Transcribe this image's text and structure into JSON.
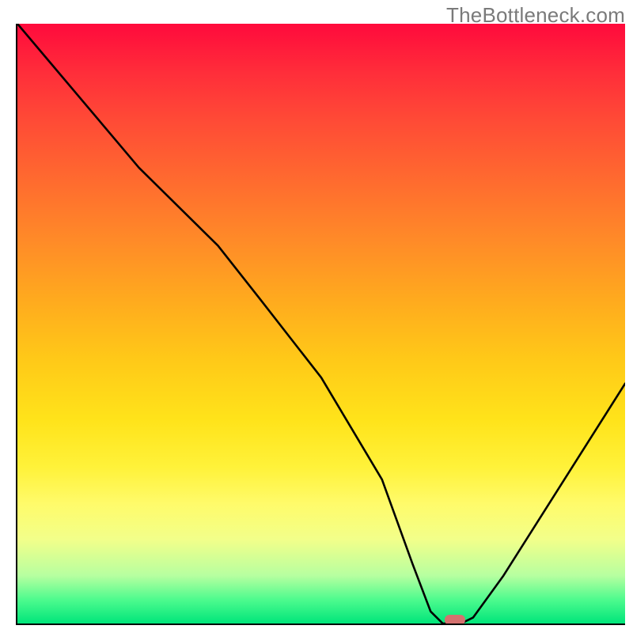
{
  "watermark": "TheBottleneck.com",
  "chart_data": {
    "type": "line",
    "title": "",
    "xlabel": "",
    "ylabel": "",
    "x": [
      0,
      5,
      10,
      15,
      20,
      25,
      30,
      33,
      40,
      50,
      60,
      65,
      68,
      70,
      73,
      75,
      80,
      85,
      90,
      95,
      100
    ],
    "values": [
      100,
      94,
      88,
      82,
      76,
      71,
      66,
      63,
      54,
      41,
      24,
      10,
      2,
      0,
      0,
      1,
      8,
      16,
      24,
      32,
      40
    ],
    "xlim": [
      0,
      100
    ],
    "ylim": [
      0,
      100
    ],
    "optimum_marker": {
      "x": 72,
      "y": 0
    },
    "background_gradient": {
      "top": "#ff0a3c",
      "bottom": "#00e57a",
      "type": "red-yellow-green"
    }
  }
}
